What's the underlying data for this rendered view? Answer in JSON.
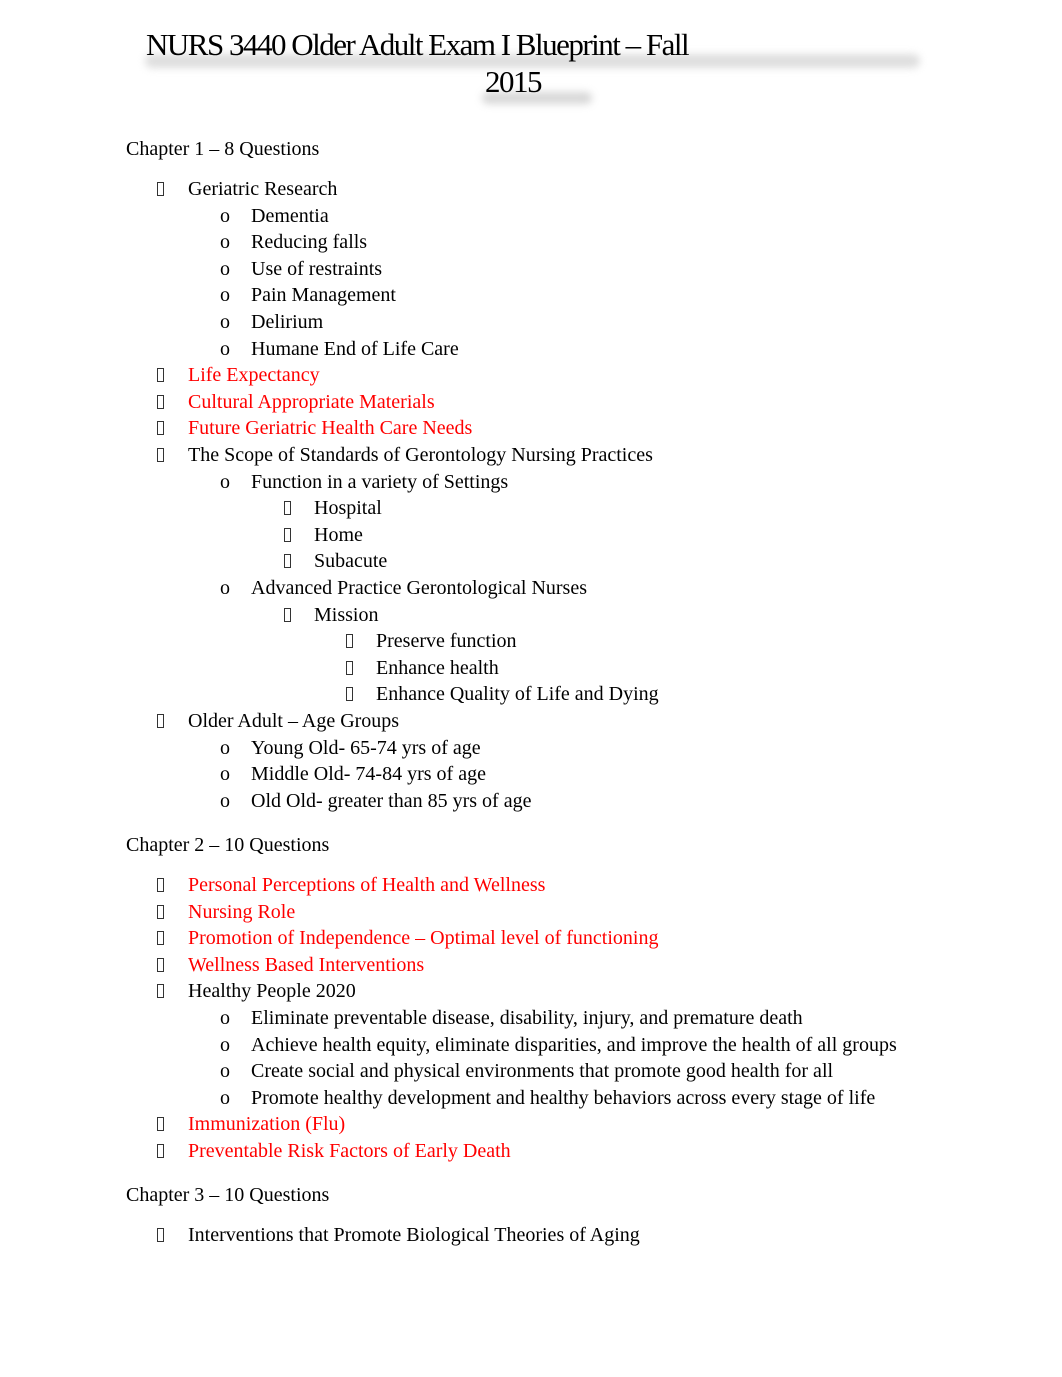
{
  "document": {
    "title_line1": "NURS 3440 Older Adult Exam I Blueprint – Fall",
    "title_line2": "2015",
    "colors": {
      "text": "#000000",
      "highlight": "#ff0000"
    },
    "markers": {
      "level1": "missing-glyph-bullet",
      "level2": "o",
      "level3": "missing-glyph-bullet",
      "level4": "missing-glyph-bullet"
    }
  },
  "chapters": [
    {
      "heading": "Chapter 1 – 8 Questions",
      "items": [
        {
          "text": "Geriatric Research",
          "level": 1,
          "red": false
        },
        {
          "text": "Dementia",
          "level": 2,
          "red": false
        },
        {
          "text": "Reducing falls",
          "level": 2,
          "red": false
        },
        {
          "text": "Use of restraints",
          "level": 2,
          "red": false
        },
        {
          "text": "Pain Management",
          "level": 2,
          "red": false
        },
        {
          "text": "Delirium",
          "level": 2,
          "red": false
        },
        {
          "text": "Humane End of Life Care",
          "level": 2,
          "red": false
        },
        {
          "text": "Life Expectancy",
          "level": 1,
          "red": true
        },
        {
          "text": "Cultural Appropriate Materials",
          "level": 1,
          "red": true
        },
        {
          "text": "Future Geriatric Health Care Needs",
          "level": 1,
          "red": true
        },
        {
          "text": "The Scope of Standards of Gerontology Nursing Practices",
          "level": 1,
          "red": false
        },
        {
          "text": "Function in a variety of Settings",
          "level": 2,
          "red": false
        },
        {
          "text": "Hospital",
          "level": 3,
          "red": false
        },
        {
          "text": "Home",
          "level": 3,
          "red": false
        },
        {
          "text": "Subacute",
          "level": 3,
          "red": false
        },
        {
          "text": "Advanced Practice Gerontological Nurses",
          "level": 2,
          "red": false
        },
        {
          "text": "Mission",
          "level": 3,
          "red": false
        },
        {
          "text": "Preserve function",
          "level": 4,
          "red": false
        },
        {
          "text": "Enhance health",
          "level": 4,
          "red": false
        },
        {
          "text": "Enhance Quality of Life and Dying",
          "level": 4,
          "red": false
        },
        {
          "text": "Older Adult – Age Groups",
          "level": 1,
          "red": false
        },
        {
          "text": "Young Old- 65-74 yrs of age",
          "level": 2,
          "red": false
        },
        {
          "text": "Middle Old- 74-84 yrs of age",
          "level": 2,
          "red": false
        },
        {
          "text": "Old Old- greater than 85 yrs of age",
          "level": 2,
          "red": false
        }
      ]
    },
    {
      "heading": "Chapter 2 – 10 Questions",
      "items": [
        {
          "text": "Personal Perceptions of Health and Wellness",
          "level": 1,
          "red": true
        },
        {
          "text": "Nursing Role",
          "level": 1,
          "red": true
        },
        {
          "text": "Promotion of Independence – Optimal level of functioning",
          "level": 1,
          "red": true
        },
        {
          "text": "Wellness Based Interventions",
          "level": 1,
          "red": true
        },
        {
          "text": "Healthy People 2020",
          "level": 1,
          "red": false
        },
        {
          "text": "Eliminate preventable disease, disability, injury, and premature death",
          "level": 2,
          "red": false
        },
        {
          "text": "Achieve health equity, eliminate disparities, and improve the health of all groups",
          "level": 2,
          "red": false
        },
        {
          "text": "Create social and physical environments that promote good health for all",
          "level": 2,
          "red": false
        },
        {
          "text": "Promote healthy development and healthy behaviors across every stage of life",
          "level": 2,
          "red": false
        },
        {
          "text": "Immunization (Flu)",
          "level": 1,
          "red": true
        },
        {
          "text": "Preventable Risk Factors of Early Death",
          "level": 1,
          "red": true
        }
      ]
    },
    {
      "heading": "Chapter 3 – 10 Questions",
      "items": [
        {
          "text": "Interventions that Promote Biological Theories of Aging",
          "level": 1,
          "red": false
        }
      ]
    }
  ]
}
